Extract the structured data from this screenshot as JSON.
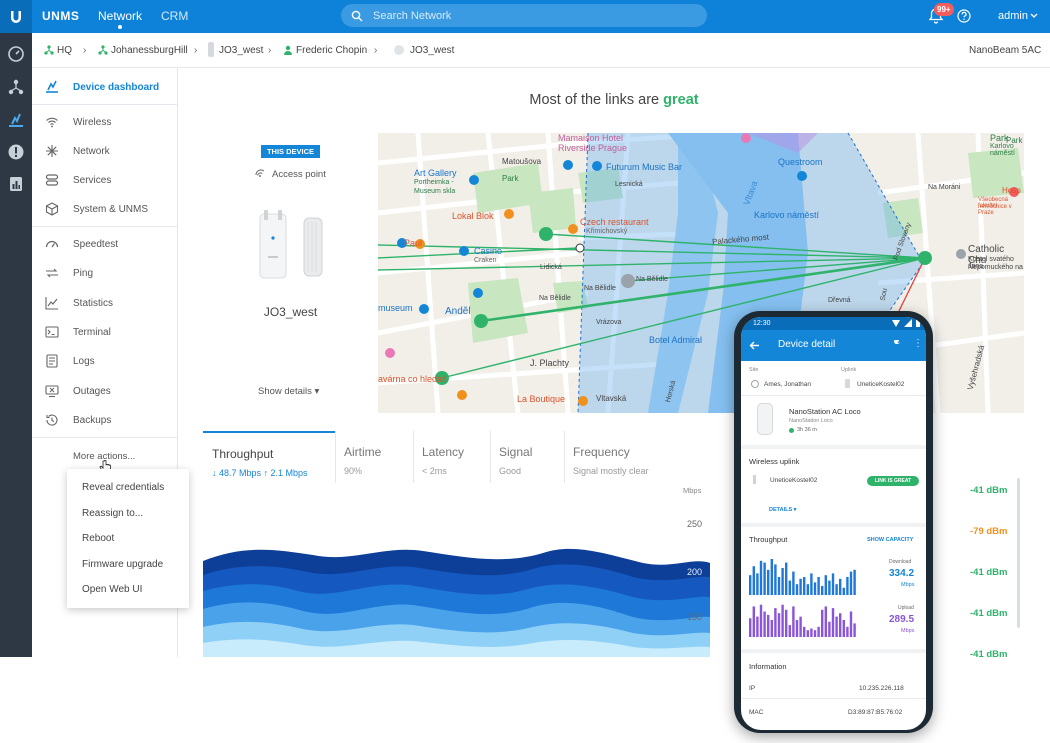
{
  "brand": "UNMS",
  "nav": {
    "network": "Network",
    "crm": "CRM"
  },
  "search": {
    "placeholder": "Search Network"
  },
  "notifications": {
    "badge": "99+"
  },
  "user": {
    "name": "admin"
  },
  "breadcrumb": {
    "items": [
      "HQ",
      "JohanessburgHill",
      "JO3_west",
      "Frederic Chopin",
      "JO3_west"
    ],
    "model": "NanoBeam 5AC"
  },
  "sidebar": {
    "items": [
      {
        "label": "Device dashboard",
        "icon": "dashboard-icon",
        "active": true
      },
      {
        "label": "Wireless",
        "icon": "wifi-icon"
      },
      {
        "label": "Network",
        "icon": "network-icon"
      },
      {
        "label": "Services",
        "icon": "services-icon"
      },
      {
        "label": "System & UNMS",
        "icon": "system-icon"
      },
      {
        "label": "Speedtest",
        "icon": "speedometer-icon"
      },
      {
        "label": "Ping",
        "icon": "ping-icon"
      },
      {
        "label": "Statistics",
        "icon": "chart-icon"
      },
      {
        "label": "Terminal",
        "icon": "terminal-icon"
      },
      {
        "label": "Logs",
        "icon": "logs-icon"
      },
      {
        "label": "Outages",
        "icon": "outages-icon"
      },
      {
        "label": "Backups",
        "icon": "backup-icon"
      }
    ],
    "more_actions": "More actions..."
  },
  "more_actions_menu": [
    "Reveal credentials",
    "Reassign to...",
    "Reboot",
    "Firmware upgrade",
    "Open Web UI"
  ],
  "headline": {
    "prefix": "Most of the links are ",
    "status": "great"
  },
  "device_card": {
    "badge": "THIS DEVICE",
    "role": "Access point",
    "name": "JO3_west",
    "show_details": "Show details"
  },
  "map": {
    "labels": [
      "Mamaison Hotel",
      "Riverside Prague",
      "Matoušova",
      "Futurum Music Bar",
      "Questroom",
      "Park",
      "Karlovo náměstí",
      "Art Gallery",
      "Portheimka -",
      "Museum skla",
      "Park",
      "Lesnická",
      "Lokal Blok",
      "Czech restaurant",
      "Vltava",
      "Křimichovský",
      "Palackého most",
      "Casino",
      "Craken",
      "Lidická",
      "Na Bělidle",
      "Na Bělidle",
      "Na Bělidle",
      "museum",
      "Anděl",
      "Vrázova",
      "J. Plachty",
      "Botel Admiral",
      "La Boutique",
      "Vltavská",
      "avárna co hledáš",
      "Catholic Chu",
      "Kostel svatého Jana",
      "Nepomuckého na",
      "Park",
      "Karlovo náměstí",
      "Na Moráni",
      "Hosp",
      "Všeobecná fakultní",
      "nemocnice v Praze",
      "Dřevná",
      "Pod Slovany",
      "Vyšehradská",
      "Paul",
      "Horská",
      "Sou"
    ]
  },
  "throughput": {
    "tabs": [
      {
        "title": "Throughput",
        "sub": "↓ 48.7 Mbps  ↑ 2.1 Mbps",
        "active": true
      },
      {
        "title": "Airtime",
        "sub": "90%"
      },
      {
        "title": "Latency",
        "sub": "< 2ms"
      },
      {
        "title": "Signal",
        "sub": "Good"
      },
      {
        "title": "Frequency",
        "sub": "Signal mostly clear"
      }
    ],
    "unit": "Mbps",
    "ticks": [
      "250",
      "200",
      "150"
    ]
  },
  "signal_list": [
    {
      "value": "-41 dBm",
      "color": "#2fb36b"
    },
    {
      "value": "-79 dBm",
      "color": "#f0901f"
    },
    {
      "value": "-41 dBm",
      "color": "#2fb36b"
    },
    {
      "value": "-41 dBm",
      "color": "#2fb36b"
    },
    {
      "value": "-41 dBm",
      "color": "#2fb36b"
    }
  ],
  "phone": {
    "time": "12:30",
    "title": "Device detail",
    "site_label": "Site",
    "site_value": "Ames, Jonathan",
    "uplink_label": "Uplink",
    "uplink_value": "UneticeKostel02",
    "device_name": "NanoStation AC Loco",
    "device_model": "NanoStation Loco",
    "device_uptime": "3h 36 m",
    "wireless_uplink": "Wireless uplink",
    "wireless_uplink_device": "UneticeKostel02",
    "link_status": "LINK IS GREAT",
    "details": "DETAILS",
    "throughput": "Throughput",
    "show_capacity": "SHOW CAPACITY",
    "download_label": "Download",
    "download_value": "334.2",
    "upload_label": "Upload",
    "upload_value": "289.5",
    "unit": "Mbps",
    "information": "Information",
    "ip_label": "IP",
    "ip_value": "10.235.226.118",
    "mac_label": "MAC",
    "mac_value": "D3:89:87:B5:76:02",
    "download_bars": [
      0.55,
      0.8,
      0.6,
      0.95,
      0.9,
      0.7,
      1.0,
      0.85,
      0.5,
      0.75,
      0.9,
      0.4,
      0.65,
      0.3,
      0.45,
      0.5,
      0.3,
      0.6,
      0.35,
      0.5,
      0.25,
      0.55,
      0.4,
      0.6,
      0.3,
      0.45,
      0.2,
      0.5,
      0.65,
      0.7
    ],
    "upload_bars": [
      0.55,
      0.9,
      0.6,
      0.95,
      0.75,
      0.65,
      0.5,
      0.85,
      0.7,
      0.95,
      0.8,
      0.35,
      0.9,
      0.5,
      0.6,
      0.3,
      0.2,
      0.25,
      0.2,
      0.3,
      0.8,
      0.9,
      0.45,
      0.85,
      0.6,
      0.7,
      0.5,
      0.3,
      0.75,
      0.4
    ]
  },
  "colors": {
    "primary": "#1486d8",
    "good": "#2fb36b",
    "warn": "#f0901f",
    "rail": "#2d3844"
  }
}
